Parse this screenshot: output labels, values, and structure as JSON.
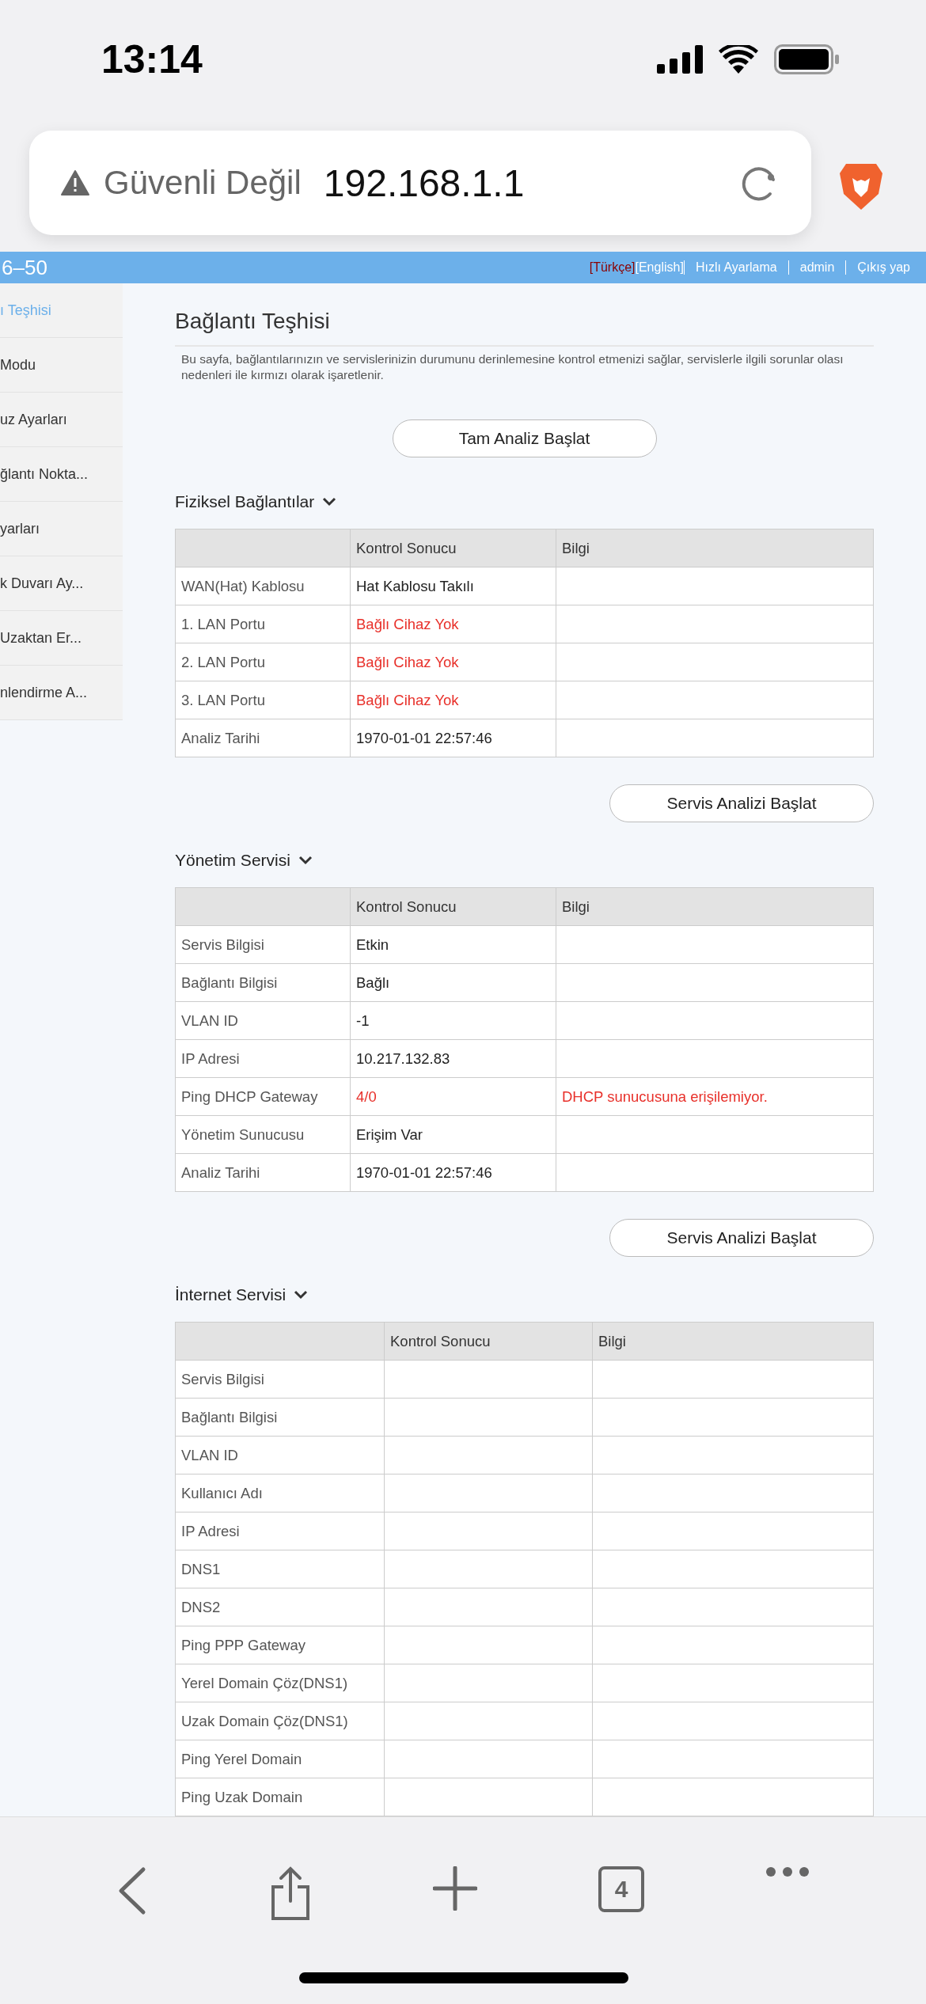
{
  "status_bar": {
    "time": "13:14"
  },
  "address_bar": {
    "security": "Güvenli Değil",
    "url": "192.168.1.1"
  },
  "router_header": {
    "model": "6–50",
    "links": [
      {
        "label": "[Türkçe]",
        "kind": "lang",
        "selected": true
      },
      {
        "label": "[English]",
        "kind": "lang",
        "selected": false
      },
      {
        "label": "Hızlı Ayarlama",
        "kind": "link"
      },
      {
        "label": "admin",
        "kind": "link"
      },
      {
        "label": "Çıkış yap",
        "kind": "link"
      }
    ]
  },
  "sidebar": {
    "items": [
      {
        "label": "ı Teşhisi",
        "selected": true
      },
      {
        "label": "Modu",
        "selected": false
      },
      {
        "label": "uz Ayarları",
        "selected": false
      },
      {
        "label": "ğlantı Nokta...",
        "selected": false
      },
      {
        "label": "yarları",
        "selected": false
      },
      {
        "label": "k Duvarı Ay...",
        "selected": false
      },
      {
        "label": "Uzaktan Er...",
        "selected": false
      },
      {
        "label": "nlendirme A...",
        "selected": false
      }
    ]
  },
  "page": {
    "title": "Bağlantı Teşhisi",
    "description": "Bu sayfa, bağlantılarınızın ve servislerinizin durumunu derinlemesine kontrol etmenizi sağlar, servislerle ilgili sorunlar olası nedenleri ile kırmızı olarak işaretlenir.",
    "main_button": "Tam Analiz Başlat"
  },
  "sections": [
    {
      "title": "Fiziksel Bağlantılar",
      "columns": [
        "Kontrol Sonucu",
        "Bilgi"
      ],
      "rows": [
        {
          "label": "WAN(Hat) Kablosu",
          "result": "Hat Kablosu Takılı",
          "info": "",
          "alert": false
        },
        {
          "label": "1. LAN Portu",
          "result": "Bağlı Cihaz Yok",
          "info": "",
          "alert": true
        },
        {
          "label": "2. LAN Portu",
          "result": "Bağlı Cihaz Yok",
          "info": "",
          "alert": true
        },
        {
          "label": "3. LAN Portu",
          "result": "Bağlı Cihaz Yok",
          "info": "",
          "alert": true
        },
        {
          "label": "Analiz Tarihi",
          "result": "1970-01-01 22:57:46",
          "info": "",
          "alert": false
        }
      ],
      "button": "Servis Analizi Başlat"
    },
    {
      "title": "Yönetim Servisi",
      "columns": [
        "Kontrol Sonucu",
        "Bilgi"
      ],
      "rows": [
        {
          "label": "Servis Bilgisi",
          "result": "Etkin",
          "info": "",
          "alert": false
        },
        {
          "label": "Bağlantı Bilgisi",
          "result": "Bağlı",
          "info": "",
          "alert": false
        },
        {
          "label": "VLAN ID",
          "result": "-1",
          "info": "",
          "alert": false
        },
        {
          "label": "IP Adresi",
          "result": "10.217.132.83",
          "info": "",
          "alert": false
        },
        {
          "label": "Ping DHCP Gateway",
          "result": "4/0",
          "info": "DHCP sunucusuna erişilemiyor.",
          "alert": true
        },
        {
          "label": "Yönetim Sunucusu",
          "result": "Erişim Var",
          "info": "",
          "alert": false
        },
        {
          "label": "Analiz Tarihi",
          "result": "1970-01-01 22:57:46",
          "info": "",
          "alert": false
        }
      ],
      "button": "Servis Analizi Başlat"
    },
    {
      "title": "İnternet Servisi",
      "columns": [
        "Kontrol Sonucu",
        "Bilgi"
      ],
      "rows": [
        {
          "label": "Servis Bilgisi",
          "result": "",
          "info": ""
        },
        {
          "label": "Bağlantı Bilgisi",
          "result": "",
          "info": ""
        },
        {
          "label": "VLAN ID",
          "result": "",
          "info": ""
        },
        {
          "label": "Kullanıcı Adı",
          "result": "",
          "info": ""
        },
        {
          "label": "IP Adresi",
          "result": "",
          "info": ""
        },
        {
          "label": "DNS1",
          "result": "",
          "info": ""
        },
        {
          "label": "DNS2",
          "result": "",
          "info": ""
        },
        {
          "label": "Ping PPP Gateway",
          "result": "",
          "info": ""
        },
        {
          "label": "Yerel Domain Çöz(DNS1)",
          "result": "",
          "info": ""
        },
        {
          "label": "Uzak Domain Çöz(DNS1)",
          "result": "",
          "info": ""
        },
        {
          "label": "Ping Yerel Domain",
          "result": "",
          "info": ""
        },
        {
          "label": "Ping Uzak Domain",
          "result": "",
          "info": ""
        }
      ]
    }
  ],
  "toolbar": {
    "tab_count": "4"
  }
}
